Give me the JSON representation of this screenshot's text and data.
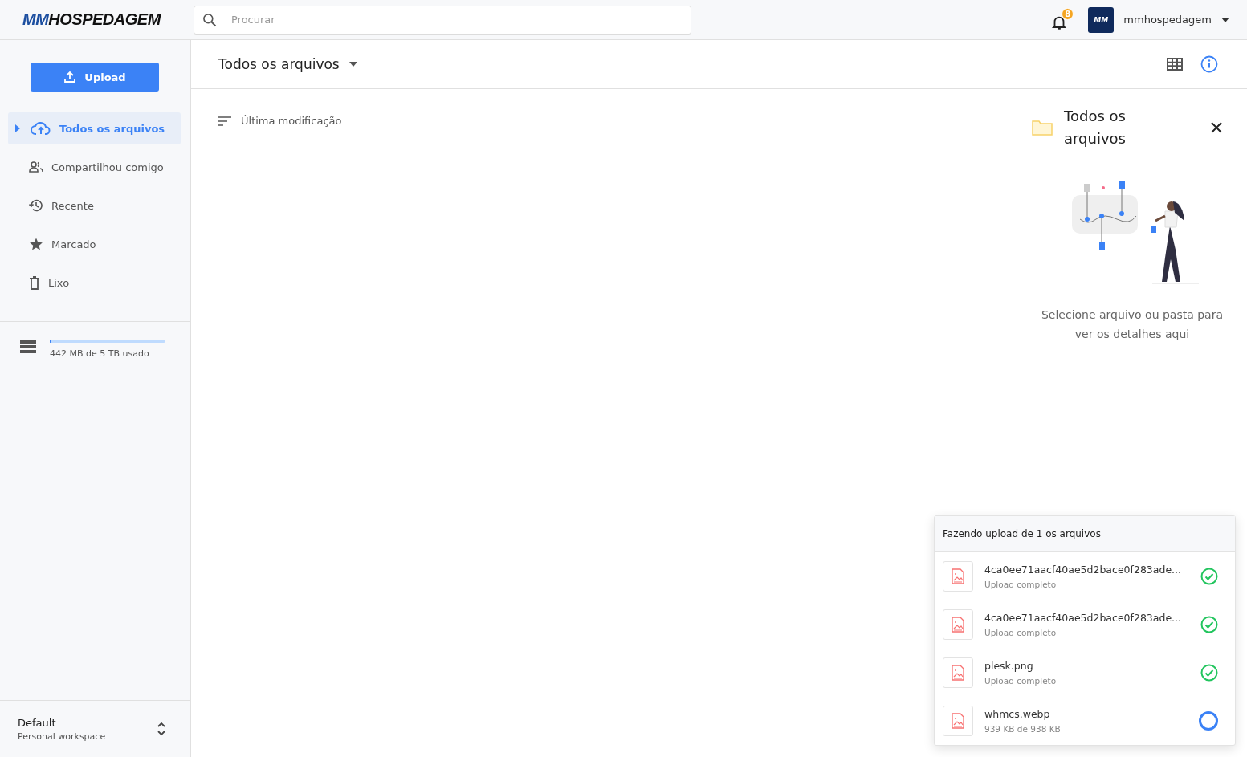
{
  "logo": {
    "prefix": "MM",
    "rest": "HOSPEDAGEM"
  },
  "search": {
    "placeholder": "Procurar"
  },
  "notifications": {
    "count": "8"
  },
  "account": {
    "avatar": "MM",
    "name": "mmhospedagem"
  },
  "sidebar": {
    "upload_button": "Upload",
    "items": [
      {
        "label": "Todos os arquivos",
        "kind": "cloud",
        "selected": true
      },
      {
        "label": "Compartilhou comigo",
        "kind": "shared",
        "selected": false
      },
      {
        "label": "Recente",
        "kind": "recent",
        "selected": false
      },
      {
        "label": "Marcado",
        "kind": "star",
        "selected": false
      },
      {
        "label": "Lixo",
        "kind": "trash",
        "selected": false
      }
    ],
    "storage": {
      "level": 0.01,
      "text": "442 MB de 5 TB usado"
    },
    "workspace": {
      "name": "Default",
      "subtitle": "Personal workspace"
    }
  },
  "main": {
    "title": "Todos os arquivos",
    "sort": "Última modificação"
  },
  "details": {
    "title": "Todos os arquivos",
    "message": "Selecione arquivo ou pasta para ver os detalhes aqui"
  },
  "uploads": {
    "title": "Fazendo upload de 1 os arquivos",
    "items": [
      {
        "name": "4ca0ee71aacf40ae5d2bace0f283ade...",
        "status": "Upload completo",
        "kind": "done"
      },
      {
        "name": "4ca0ee71aacf40ae5d2bace0f283ade...",
        "status": "Upload completo",
        "kind": "done"
      },
      {
        "name": "plesk.png",
        "status": "Upload completo",
        "kind": "done"
      },
      {
        "name": "whmcs.webp",
        "status": "939 KB de 938 KB",
        "kind": "uploading"
      }
    ]
  }
}
